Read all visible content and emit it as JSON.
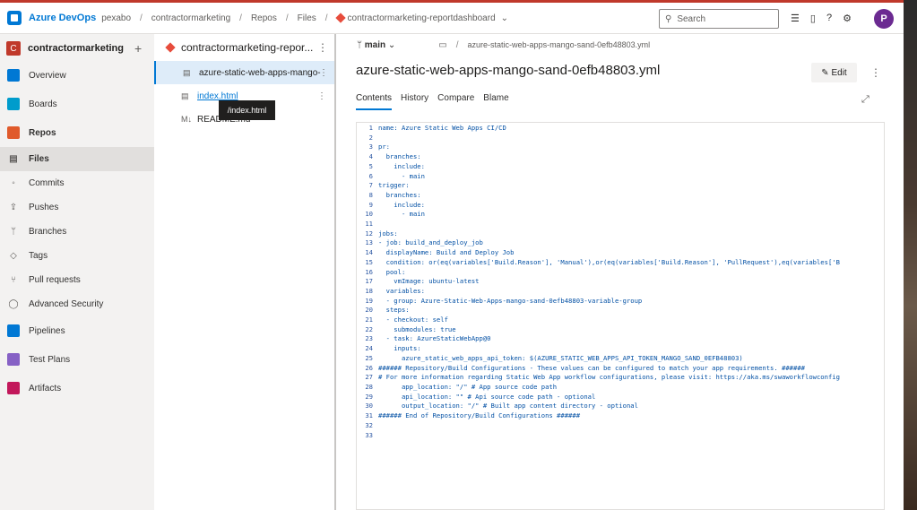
{
  "topbar": {
    "brand": "Azure DevOps",
    "org": "pexabo",
    "project": "contractormarketing",
    "repos": "Repos",
    "files": "Files",
    "repo": "contractormarketing-reportdashboard",
    "search_placeholder": "Search",
    "avatar_initial": "P"
  },
  "sidebar": {
    "project_initial": "C",
    "project_name": "contractormarketing",
    "items": [
      {
        "label": "Overview",
        "color": "#0078d4"
      },
      {
        "label": "Boards",
        "color": "#009ccc"
      },
      {
        "label": "Repos",
        "color": "#e05a2b"
      },
      {
        "label": "Files"
      },
      {
        "label": "Commits"
      },
      {
        "label": "Pushes"
      },
      {
        "label": "Branches"
      },
      {
        "label": "Tags"
      },
      {
        "label": "Pull requests"
      },
      {
        "label": "Advanced Security"
      },
      {
        "label": "Pipelines",
        "color": "#0078d4"
      },
      {
        "label": "Test Plans",
        "color": "#8661c5"
      },
      {
        "label": "Artifacts",
        "color": "#c2185b"
      }
    ]
  },
  "filetree": {
    "repo_name": "contractormarketing-repor...",
    "files": [
      {
        "name": "azure-static-web-apps-mango-"
      },
      {
        "name": "index.html"
      },
      {
        "name": "README.md"
      }
    ],
    "tooltip": "/index.html"
  },
  "main": {
    "branch": "main",
    "path": "azure-static-web-apps-mango-sand-0efb48803.yml",
    "title": "azure-static-web-apps-mango-sand-0efb48803.yml",
    "edit_label": "Edit",
    "tabs": [
      "Contents",
      "History",
      "Compare",
      "Blame"
    ],
    "code_lines": [
      "name: Azure Static Web Apps CI/CD",
      "",
      "pr:",
      "  branches:",
      "    include:",
      "      - main",
      "trigger:",
      "  branches:",
      "    include:",
      "      - main",
      "",
      "jobs:",
      "- job: build_and_deploy_job",
      "  displayName: Build and Deploy Job",
      "  condition: or(eq(variables['Build.Reason'], 'Manual'),or(eq(variables['Build.Reason'], 'PullRequest'),eq(variables['B",
      "  pool:",
      "    vmImage: ubuntu-latest",
      "  variables:",
      "  - group: Azure-Static-Web-Apps-mango-sand-0efb48803-variable-group",
      "  steps:",
      "  - checkout: self",
      "    submodules: true",
      "  - task: AzureStaticWebApp@0",
      "    inputs:",
      "      azure_static_web_apps_api_token: $(AZURE_STATIC_WEB_APPS_API_TOKEN_MANGO_SAND_0EFB48803)",
      "###### Repository/Build Configurations - These values can be configured to match your app requirements. ######",
      "# For more information regarding Static Web App workflow configurations, please visit: https://aka.ms/swaworkflowconfig",
      "      app_location: \"/\" # App source code path",
      "      api_location: \"\" # Api source code path - optional",
      "      output_location: \"/\" # Built app content directory - optional",
      "###### End of Repository/Build Configurations ######",
      "",
      ""
    ]
  }
}
